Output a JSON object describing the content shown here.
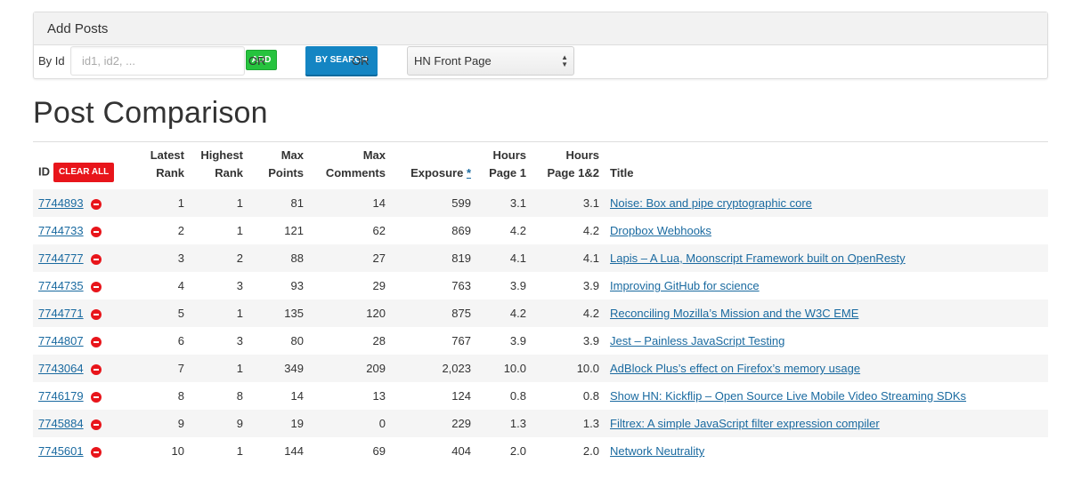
{
  "add_posts": {
    "title": "Add Posts",
    "by_id_label": "By Id",
    "id_input_placeholder": "id1, id2, ...",
    "add_button": "ADD",
    "or1": "OR",
    "search_button": "BY SEARCH",
    "or2": "OR",
    "source_select_value": "HN Front Page"
  },
  "page_title": "Post Comparison",
  "table": {
    "headers": {
      "id": "ID",
      "clear_all": "CLEAR ALL",
      "latest_rank": [
        "Latest",
        "Rank"
      ],
      "highest_rank": [
        "Highest",
        "Rank"
      ],
      "max_points": [
        "Max",
        "Points"
      ],
      "max_comments": [
        "Max",
        "Comments"
      ],
      "exposure": "Exposure",
      "exposure_link": "*",
      "hours_page1": [
        "Hours",
        "Page 1"
      ],
      "hours_page12": [
        "Hours",
        "Page 1&2"
      ],
      "title": "Title"
    },
    "rows": [
      {
        "id": "7744893",
        "latest": "1",
        "highest": "1",
        "points": "81",
        "comments": "14",
        "exposure": "599",
        "h1": "3.1",
        "h12": "3.1",
        "title": "Noise: Box and pipe cryptographic core"
      },
      {
        "id": "7744733",
        "latest": "2",
        "highest": "1",
        "points": "121",
        "comments": "62",
        "exposure": "869",
        "h1": "4.2",
        "h12": "4.2",
        "title": "Dropbox Webhooks"
      },
      {
        "id": "7744777",
        "latest": "3",
        "highest": "2",
        "points": "88",
        "comments": "27",
        "exposure": "819",
        "h1": "4.1",
        "h12": "4.1",
        "title": "Lapis – A Lua, Moonscript Framework built on OpenResty"
      },
      {
        "id": "7744735",
        "latest": "4",
        "highest": "3",
        "points": "93",
        "comments": "29",
        "exposure": "763",
        "h1": "3.9",
        "h12": "3.9",
        "title": "Improving GitHub for science"
      },
      {
        "id": "7744771",
        "latest": "5",
        "highest": "1",
        "points": "135",
        "comments": "120",
        "exposure": "875",
        "h1": "4.2",
        "h12": "4.2",
        "title": "Reconciling Mozilla’s Mission and the W3C EME"
      },
      {
        "id": "7744807",
        "latest": "6",
        "highest": "3",
        "points": "80",
        "comments": "28",
        "exposure": "767",
        "h1": "3.9",
        "h12": "3.9",
        "title": "Jest – Painless JavaScript Testing"
      },
      {
        "id": "7743064",
        "latest": "7",
        "highest": "1",
        "points": "349",
        "comments": "209",
        "exposure": "2,023",
        "h1": "10.0",
        "h12": "10.0",
        "title": "AdBlock Plus’s effect on Firefox’s memory usage"
      },
      {
        "id": "7746179",
        "latest": "8",
        "highest": "8",
        "points": "14",
        "comments": "13",
        "exposure": "124",
        "h1": "0.8",
        "h12": "0.8",
        "title": "Show HN: Kickflip – Open Source Live Mobile Video Streaming SDKs"
      },
      {
        "id": "7745884",
        "latest": "9",
        "highest": "9",
        "points": "19",
        "comments": "0",
        "exposure": "229",
        "h1": "1.3",
        "h12": "1.3",
        "title": "Filtrex: A simple JavaScript filter expression compiler"
      },
      {
        "id": "7745601",
        "latest": "10",
        "highest": "1",
        "points": "144",
        "comments": "69",
        "exposure": "404",
        "h1": "2.0",
        "h12": "2.0",
        "title": "Network Neutrality"
      }
    ]
  },
  "colors": {
    "add_button": "#26c33e",
    "search_button": "#1485c3",
    "clear_button": "#e8151b",
    "link": "#1a6aa0",
    "row_stripe": "#f5f5f5"
  },
  "icons": {
    "remove": "minus-circle-icon",
    "select_arrows": "up-down-arrows-icon"
  }
}
